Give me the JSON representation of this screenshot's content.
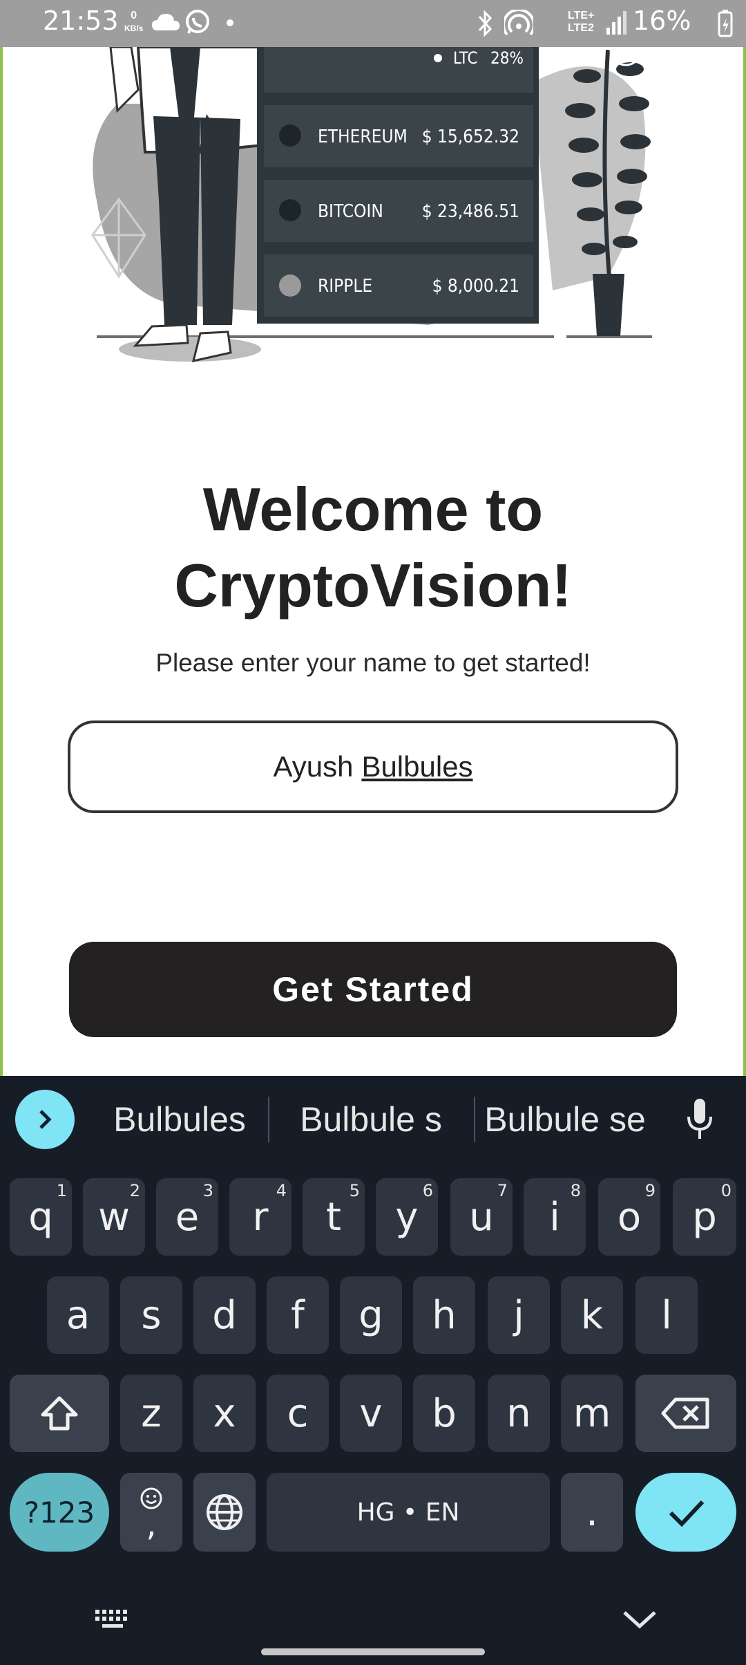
{
  "status_bar": {
    "time": "21:53",
    "net_speed_top": "0",
    "net_speed_unit": "KB/s",
    "lte_top": "LTE+",
    "lte_bottom": "LTE2",
    "battery": "16%"
  },
  "illustration": {
    "rows": [
      {
        "name": "LTC",
        "value": "28%"
      },
      {
        "name": "ETHEREUM",
        "value": "$ 15,652.32"
      },
      {
        "name": "BITCOIN",
        "value": "$ 23,486.51"
      },
      {
        "name": "RIPPLE",
        "value": "$ 8,000.21"
      }
    ]
  },
  "main": {
    "title_line1": "Welcome to",
    "title_line2": "CryptoVision!",
    "subtitle": "Please enter your name to get started!",
    "name_value_first": "Ayush",
    "name_value_last": "Bulbules",
    "button_label": "Get Started"
  },
  "keyboard": {
    "suggestions": [
      "Bulbules",
      "Bulbule s",
      "Bulbule se"
    ],
    "row1": [
      {
        "k": "q",
        "h": "1"
      },
      {
        "k": "w",
        "h": "2"
      },
      {
        "k": "e",
        "h": "3"
      },
      {
        "k": "r",
        "h": "4"
      },
      {
        "k": "t",
        "h": "5"
      },
      {
        "k": "y",
        "h": "6"
      },
      {
        "k": "u",
        "h": "7"
      },
      {
        "k": "i",
        "h": "8"
      },
      {
        "k": "o",
        "h": "9"
      },
      {
        "k": "p",
        "h": "0"
      }
    ],
    "row2": [
      "a",
      "s",
      "d",
      "f",
      "g",
      "h",
      "j",
      "k",
      "l"
    ],
    "row3": [
      "z",
      "x",
      "c",
      "v",
      "b",
      "n",
      "m"
    ],
    "symbols_label": "?123",
    "comma_label": ",",
    "space_label": "HG • EN",
    "period_label": ".",
    "accent_color": "#7fe4f4",
    "symbols_color": "#5fb7c2"
  }
}
